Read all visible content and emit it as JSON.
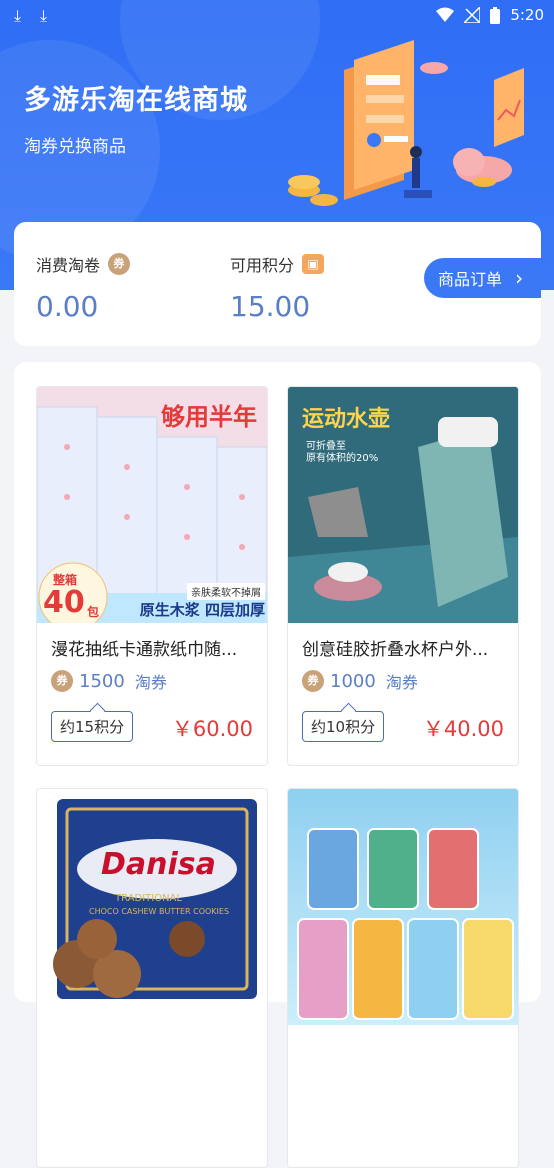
{
  "status": {
    "time": "5:20"
  },
  "header": {
    "title": "多游乐淘在线商城",
    "subtitle": "淘券兑换商品"
  },
  "summary": {
    "coupon_label": "消费淘卷",
    "coupon_value": "0.00",
    "points_label": "可用积分",
    "points_value": "15.00",
    "order_button": "商品订单",
    "order_chevron": "›"
  },
  "products": [
    {
      "name": "漫花抽纸卡通款纸巾随...",
      "coupon": "1500",
      "unit": "淘券",
      "points": "约15积分",
      "price": "￥60.00",
      "img_banner": "够用半年",
      "img_badge_top": "整箱",
      "img_badge_num": "40",
      "img_badge_unit": "包",
      "img_note": "亲肤柔软不掉屑",
      "img_strip": "原生木浆 四层加厚"
    },
    {
      "name": "创意硅胶折叠水杯户外...",
      "coupon": "1000",
      "unit": "淘券",
      "points": "约10积分",
      "price": "￥40.00",
      "img_banner": "运动水壶",
      "img_note1": "可折叠至",
      "img_note2": "原有体积的20%"
    },
    {
      "img_brand": "Danisa",
      "img_line1": "TRADITIONAL",
      "img_line2": "CHOCO CASHEW BUTTER COOKIES"
    },
    {}
  ],
  "colors": {
    "brand": "#3a78f6",
    "price": "#e43a3a",
    "coupon": "#5b7fc4"
  }
}
